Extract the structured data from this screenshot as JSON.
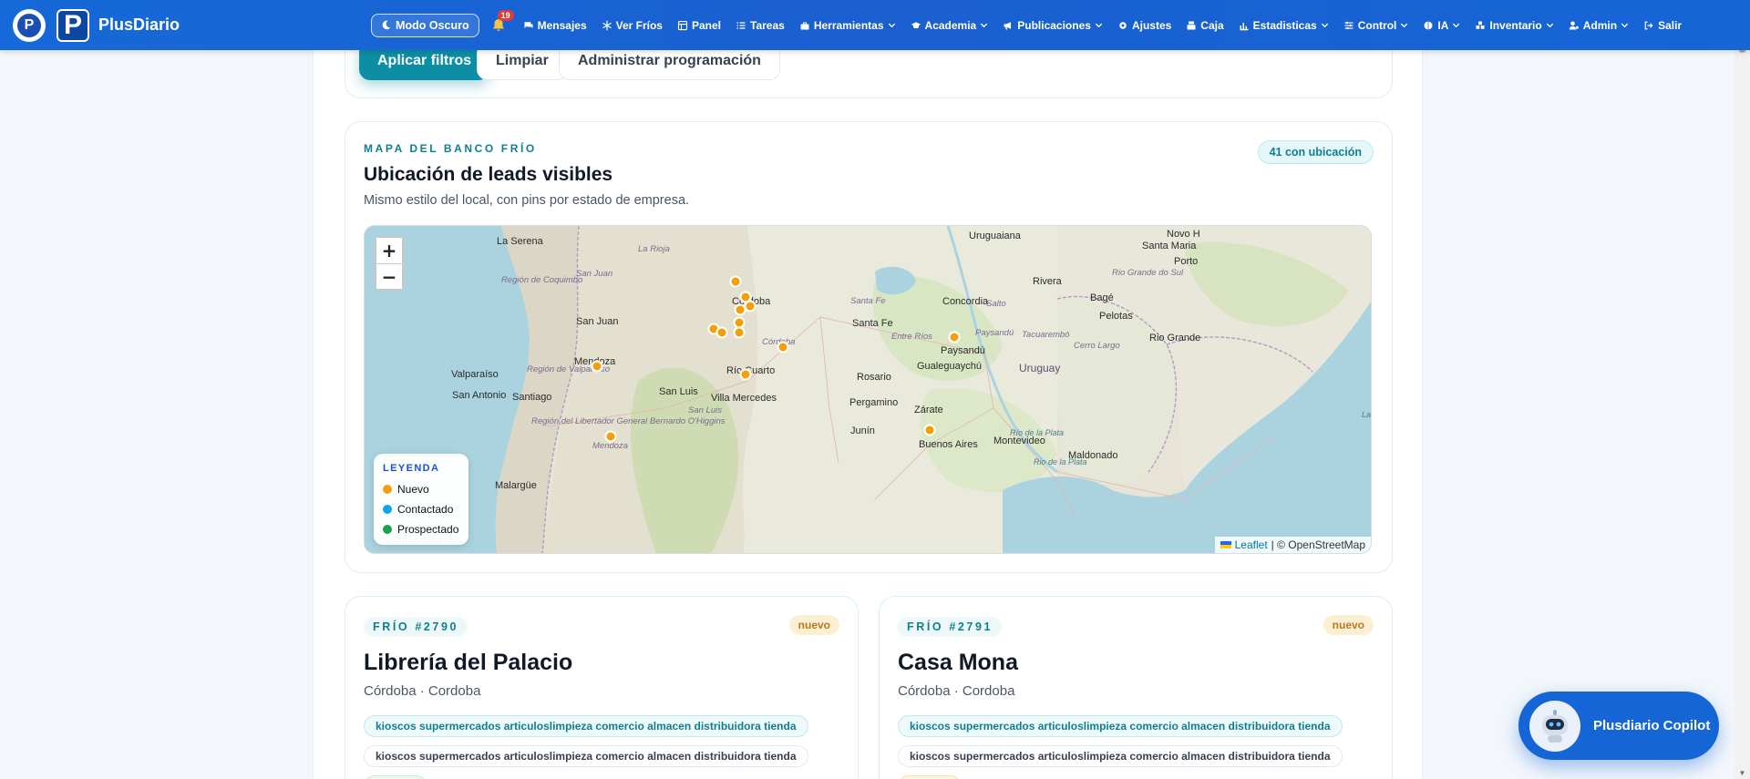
{
  "navbar": {
    "brand": "PlusDiario",
    "dark_mode_label": "Modo Oscuro",
    "notification_count": "19",
    "items": [
      {
        "label": "Mensajes",
        "icon": "chat-icon",
        "dropdown": false
      },
      {
        "label": "Ver Fríos",
        "icon": "snowflake-icon",
        "dropdown": false
      },
      {
        "label": "Panel",
        "icon": "panel-icon",
        "dropdown": false
      },
      {
        "label": "Tareas",
        "icon": "list-icon",
        "dropdown": false
      },
      {
        "label": "Herramientas",
        "icon": "toolbox-icon",
        "dropdown": true
      },
      {
        "label": "Academia",
        "icon": "graduation-cap-icon",
        "dropdown": true
      },
      {
        "label": "Publicaciones",
        "icon": "megaphone-icon",
        "dropdown": true
      },
      {
        "label": "Ajustes",
        "icon": "gear-icon",
        "dropdown": false
      },
      {
        "label": "Caja",
        "icon": "register-icon",
        "dropdown": false
      },
      {
        "label": "Estadisticas",
        "icon": "bar-chart-icon",
        "dropdown": true
      },
      {
        "label": "Control",
        "icon": "sliders-icon",
        "dropdown": true
      },
      {
        "label": "IA",
        "icon": "brain-icon",
        "dropdown": true
      },
      {
        "label": "Inventario",
        "icon": "boxes-icon",
        "dropdown": true
      },
      {
        "label": "Admin",
        "icon": "user-gear-icon",
        "dropdown": true
      },
      {
        "label": "Salir",
        "icon": "logout-icon",
        "dropdown": false
      }
    ]
  },
  "filters": {
    "apply_label": "Aplicar filtros",
    "clear_label": "Limpiar",
    "schedule_label": "Administrar programación"
  },
  "map": {
    "eyebrow": "MAPA DEL BANCO FRÍO",
    "title": "Ubicación de leads visibles",
    "subtitle": "Mismo estilo del local, con pins por estado de empresa.",
    "count_badge": "41 con ubicación",
    "zoom_in": "+",
    "zoom_out": "−",
    "legend": {
      "title": "LEYENDA",
      "items": [
        {
          "label": "Nuevo",
          "color": "#f59e0b"
        },
        {
          "label": "Contactado",
          "color": "#0ea5e9"
        },
        {
          "label": "Prospectado",
          "color": "#16a34a"
        }
      ]
    },
    "attribution": {
      "leaflet": "Leaflet",
      "rest": "| © OpenStreetMap"
    },
    "place_labels": [
      {
        "name": "La Serena",
        "cls": "city"
      },
      {
        "name": "Región de Coquimbo",
        "cls": "region"
      },
      {
        "name": "La Rioja",
        "cls": "region"
      },
      {
        "name": "San Juan",
        "cls": "region"
      },
      {
        "name": "San Juan",
        "cls": "city"
      },
      {
        "name": "Córdoba",
        "cls": "city"
      },
      {
        "name": "Santa Fe",
        "cls": "region"
      },
      {
        "name": "Santa Fe",
        "cls": "city"
      },
      {
        "name": "Mendoza",
        "cls": "city"
      },
      {
        "name": "Valparaíso",
        "cls": "city"
      },
      {
        "name": "Región de Valparaíso",
        "cls": "region"
      },
      {
        "name": "San Antonio",
        "cls": "city"
      },
      {
        "name": "Santiago",
        "cls": "city"
      },
      {
        "name": "Región del Libertador General Bernardo O'Higgins",
        "cls": "region"
      },
      {
        "name": "San Luis",
        "cls": "city"
      },
      {
        "name": "San Luis",
        "cls": "region"
      },
      {
        "name": "Villa Mercedes",
        "cls": "city"
      },
      {
        "name": "Río Cuarto",
        "cls": "city"
      },
      {
        "name": "Córdoba",
        "cls": "region"
      },
      {
        "name": "Rosario",
        "cls": "city"
      },
      {
        "name": "Entre Ríos",
        "cls": "region"
      },
      {
        "name": "Paysandú",
        "cls": "city"
      },
      {
        "name": "Gualeguaychú",
        "cls": "city"
      },
      {
        "name": "Uruguay",
        "cls": "country"
      },
      {
        "name": "Concordia",
        "cls": "city"
      },
      {
        "name": "Salto",
        "cls": "region"
      },
      {
        "name": "Pergamino",
        "cls": "city"
      },
      {
        "name": "Junín",
        "cls": "city"
      },
      {
        "name": "Zárate",
        "cls": "city"
      },
      {
        "name": "Buenos Aires",
        "cls": "city"
      },
      {
        "name": "Montevideo",
        "cls": "city"
      },
      {
        "name": "Maldonado",
        "cls": "city"
      },
      {
        "name": "Río de la Plata",
        "cls": "water"
      },
      {
        "name": "Mendoza",
        "cls": "region"
      },
      {
        "name": "Malargüe",
        "cls": "city"
      },
      {
        "name": "Uruguaiana",
        "cls": "city"
      },
      {
        "name": "Santa Maria",
        "cls": "city"
      },
      {
        "name": "Rio Grande do Sul",
        "cls": "region"
      },
      {
        "name": "Rivera",
        "cls": "city"
      },
      {
        "name": "Bagé",
        "cls": "city"
      },
      {
        "name": "Pelotas",
        "cls": "city"
      },
      {
        "name": "Rio Grande",
        "cls": "city"
      },
      {
        "name": "Porto",
        "cls": "city"
      },
      {
        "name": "Novo H",
        "cls": "city"
      },
      {
        "name": "Paysandú",
        "cls": "region"
      },
      {
        "name": "Tacuarembó",
        "cls": "region"
      },
      {
        "name": "Cerro Largo",
        "cls": "region"
      },
      {
        "name": "Rio de la Plata",
        "cls": "water"
      },
      {
        "name": "Lag",
        "cls": "water"
      }
    ]
  },
  "leads": [
    {
      "id": "FRÍO #2790",
      "status": "nuevo",
      "name": "Librería del Palacio",
      "location": "Córdoba · Cordoba",
      "tags": [
        "kioscos supermercados articuloslimpieza comercio almacen distribuidora tienda",
        "kioscos supermercados articuloslimpieza comercio almacen distribuidora tienda"
      ]
    },
    {
      "id": "FRÍO #2791",
      "status": "nuevo",
      "name": "Casa Mona",
      "location": "Córdoba · Cordoba",
      "tags": [
        "kioscos supermercados articuloslimpieza comercio almacen distribuidora tienda",
        "kioscos supermercados articuloslimpieza comercio almacen distribuidora tienda"
      ]
    }
  ],
  "copilot": {
    "label": "Plusdiario Copilot"
  }
}
